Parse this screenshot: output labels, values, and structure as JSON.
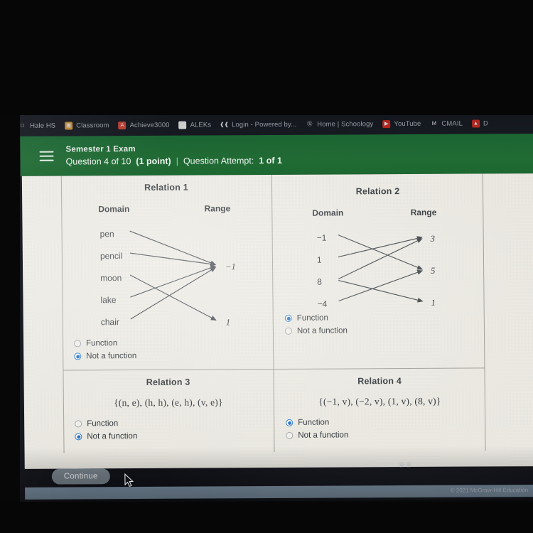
{
  "browser": {
    "bookmarks": [
      {
        "label": "Hale HS",
        "icon": "folder-icon",
        "glyph": "□",
        "cls": "ico-folder"
      },
      {
        "label": "Classroom",
        "icon": "google-classroom-icon",
        "glyph": "▣",
        "cls": "ico-classroom"
      },
      {
        "label": "Achieve3000",
        "icon": "achieve3000-icon",
        "glyph": "A",
        "cls": "ico-achieve"
      },
      {
        "label": "ALEKs",
        "icon": "google-icon",
        "glyph": "G",
        "cls": "ico-google"
      },
      {
        "label": "Login - Powered by...",
        "icon": "clever-icon",
        "glyph": "❰❰",
        "cls": "ico-login"
      },
      {
        "label": "Home | Schoology",
        "icon": "schoology-icon",
        "glyph": "Ⓢ",
        "cls": "ico-schoology"
      },
      {
        "label": "YouTube",
        "icon": "youtube-icon",
        "glyph": "▶",
        "cls": "ico-youtube"
      },
      {
        "label": "CMAIL",
        "icon": "gmail-icon",
        "glyph": "M",
        "cls": "ico-gmail"
      },
      {
        "label": "D",
        "icon": "drive-icon",
        "glyph": "▲",
        "cls": "ico-drive"
      }
    ]
  },
  "header": {
    "menu_icon": "hamburger-icon",
    "exam_title": "Semester 1 Exam",
    "question_label": "Question 4 of 10",
    "points_label": "(1 point)",
    "separator": "|",
    "attempt_label": "Question Attempt:",
    "attempt_value": "1 of 1",
    "accent_color": "#1e7038"
  },
  "relations": [
    {
      "title": "Relation 1",
      "type": "mapping",
      "domain_header": "Domain",
      "range_header": "Range",
      "domain": [
        "pen",
        "pencil",
        "moon",
        "lake",
        "chair"
      ],
      "range": [
        "−1",
        "1"
      ],
      "arrows": [
        {
          "from": 0,
          "to": 0
        },
        {
          "from": 1,
          "to": 0
        },
        {
          "from": 2,
          "to": 1
        },
        {
          "from": 3,
          "to": 0
        },
        {
          "from": 4,
          "to": 0
        }
      ],
      "choices": [
        "Function",
        "Not a function"
      ],
      "selected": 1
    },
    {
      "title": "Relation 2",
      "type": "mapping",
      "domain_header": "Domain",
      "range_header": "Range",
      "domain": [
        "−1",
        "1",
        "8",
        "−4"
      ],
      "range": [
        "3",
        "5",
        "1"
      ],
      "arrows": [
        {
          "from": 0,
          "to": 1
        },
        {
          "from": 1,
          "to": 0
        },
        {
          "from": 2,
          "to": 0
        },
        {
          "from": 2,
          "to": 2
        },
        {
          "from": 3,
          "to": 1
        }
      ],
      "choices": [
        "Function",
        "Not a function"
      ],
      "selected": 0
    },
    {
      "title": "Relation 3",
      "type": "set",
      "set_notation": "{(n, e), (h, h), (e, h), (v, e)}",
      "choices": [
        "Function",
        "Not a function"
      ],
      "selected": 1
    },
    {
      "title": "Relation 4",
      "type": "set",
      "set_notation": "{(−1, v), (−2, v), (1, v), (8, v)}",
      "choices": [
        "Function",
        "Not a function"
      ],
      "selected": 0
    }
  ],
  "footer": {
    "continue_label": "Continue",
    "copyright": "© 2021 McGraw-Hill Education"
  }
}
